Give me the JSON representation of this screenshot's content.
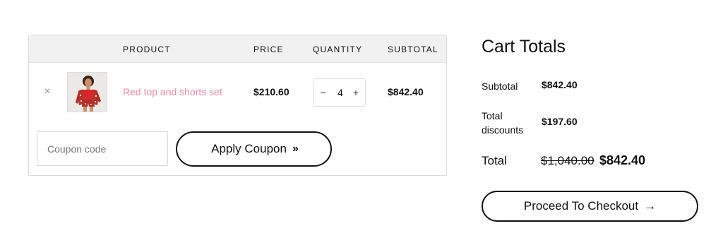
{
  "cart": {
    "headers": {
      "product": "Product",
      "price": "Price",
      "quantity": "Quantity",
      "subtotal": "Subtotal"
    },
    "items": [
      {
        "remove_icon": "×",
        "thumbnail_icon": "product-thumbnail",
        "name": "Red top and shorts set",
        "price": "$210.60",
        "quantity": "4",
        "minus": "−",
        "plus": "+",
        "subtotal": "$842.40"
      }
    ],
    "coupon": {
      "placeholder": "Coupon code",
      "value": "",
      "apply_label": "Apply Coupon",
      "apply_icon": "»"
    }
  },
  "totals": {
    "title": "Cart Totals",
    "subtotal_label": "Subtotal",
    "subtotal_value": "$842.40",
    "discounts_label": "Total discounts",
    "discounts_value": "$197.60",
    "total_label": "Total",
    "total_original": "$1,040.00",
    "total_value": "$842.40",
    "checkout_label": "Proceed To Checkout",
    "checkout_icon": "→"
  },
  "colors": {
    "link": "#f08aa6",
    "header_bg": "#f1f1f2",
    "text": "#111111",
    "border": "#dcdcdc"
  }
}
